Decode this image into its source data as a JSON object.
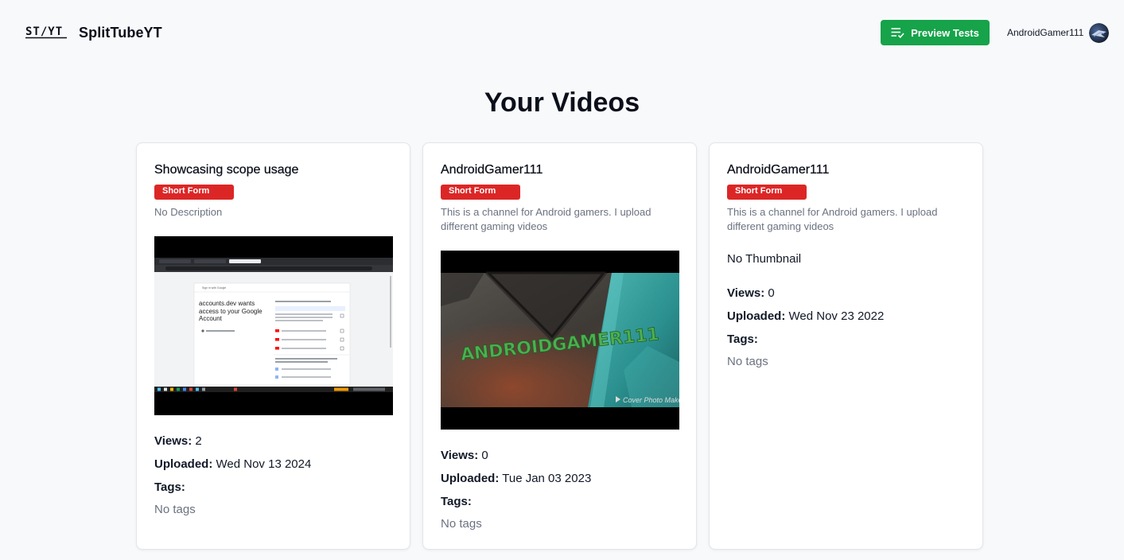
{
  "header": {
    "logo_text": "ST/YT",
    "brand": "SplitTubeYT",
    "preview_label": "Preview Tests",
    "username": "AndroidGamer111"
  },
  "page": {
    "title": "Your Videos"
  },
  "labels": {
    "views": "Views:",
    "uploaded": "Uploaded:",
    "tags": "Tags:"
  },
  "videos": [
    {
      "title": "Showcasing scope usage",
      "badge": "Short Form",
      "description": "No Description",
      "views": "2",
      "uploaded": "Wed Nov 13 2024",
      "tags": "No tags",
      "thumbnail": {
        "heading": "accounts.dev wants access to your Google Account",
        "search_text": "Sign in with Google"
      }
    },
    {
      "title": "AndroidGamer111",
      "badge": "Short Form",
      "description": "This is a channel for Android gamers. I upload different gaming videos",
      "views": "0",
      "uploaded": "Tue Jan 03 2023",
      "tags": "No tags",
      "thumbnail": {
        "logo_text": "ANDROIDGAMER111",
        "watermark": "Cover Photo Maker"
      }
    },
    {
      "title": "AndroidGamer111",
      "badge": "Short Form",
      "description": "This is a channel for Android gamers. I upload different gaming videos",
      "no_thumbnail": "No Thumbnail",
      "views": "0",
      "uploaded": "Wed Nov 23 2022",
      "tags": "No tags"
    }
  ],
  "colors": {
    "background": "#f8f9fb",
    "primary_button": "#16a34a",
    "badge": "#dc2626",
    "muted_text": "#6b7280"
  }
}
